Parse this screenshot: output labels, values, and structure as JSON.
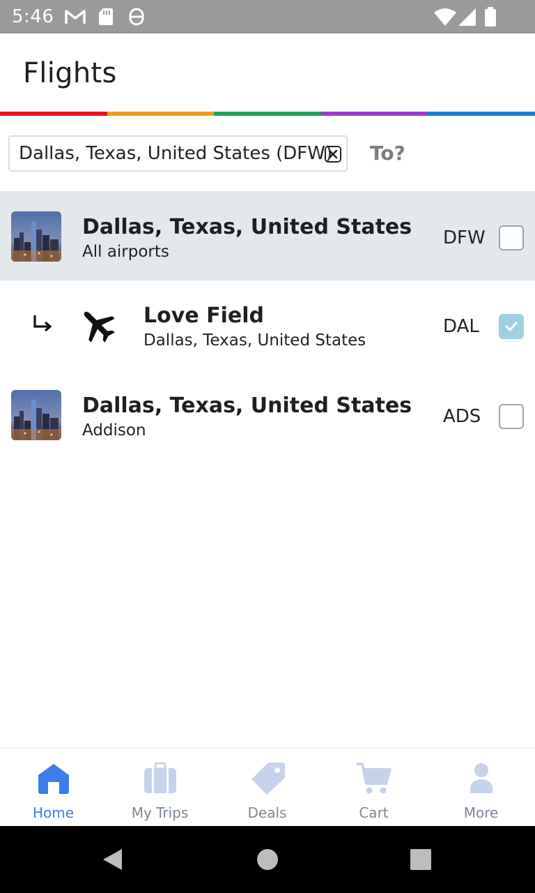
{
  "status_bar": {
    "time": "5:46",
    "left_icons": [
      "gmail-icon",
      "sd-card-icon",
      "vpn-icon"
    ],
    "right_icons": [
      "wifi-icon",
      "cellular-signal-icon",
      "battery-icon"
    ]
  },
  "header": {
    "title": "Flights"
  },
  "rainbow_colors": [
    "#e8141c",
    "#f29b1d",
    "#23a05a",
    "#9a3ec9",
    "#1a7ed6"
  ],
  "search": {
    "from_value": "Dallas, Texas, United States (DFW)",
    "to_placeholder": "To?"
  },
  "results": [
    {
      "title": "Dallas, Texas, United States",
      "subtitle": "All airports",
      "code": "DFW",
      "checked": false,
      "highlighted": true,
      "icon": "city-skyline-thumbnail"
    },
    {
      "title": "Love Field",
      "subtitle": "Dallas, Texas, United States",
      "code": "DAL",
      "checked": true,
      "highlighted": false,
      "icon": "airplane-icon"
    },
    {
      "title": "Dallas, Texas, United States",
      "subtitle": "Addison",
      "code": "ADS",
      "checked": false,
      "highlighted": false,
      "icon": "city-skyline-thumbnail"
    }
  ],
  "bottom_nav": {
    "items": [
      {
        "label": "Home",
        "icon": "home-icon",
        "active": true
      },
      {
        "label": "My Trips",
        "icon": "suitcase-icon",
        "active": false
      },
      {
        "label": "Deals",
        "icon": "tag-icon",
        "active": false
      },
      {
        "label": "Cart",
        "icon": "cart-icon",
        "active": false
      },
      {
        "label": "More",
        "icon": "person-icon",
        "active": false
      }
    ],
    "active_color": "#3d7dea",
    "inactive_color": "#c5d3ea"
  },
  "android_nav": {
    "buttons": [
      "back-icon",
      "home-circle-icon",
      "recents-icon"
    ]
  }
}
